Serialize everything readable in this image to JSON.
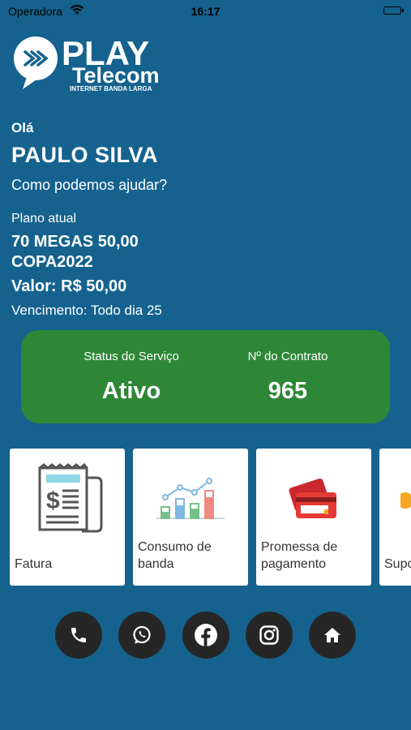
{
  "status_bar": {
    "carrier": "Operadora",
    "time": "16:17"
  },
  "brand": {
    "logo_top": "PLAY",
    "logo_bottom": "Telecom",
    "logo_tagline": "INTERNET BANDA LARGA"
  },
  "greeting": {
    "hello": "Olá",
    "name": "PAULO SILVA",
    "prompt": "Como podemos ajudar?"
  },
  "plan": {
    "label": "Plano atual",
    "name": "70 MEGAS 50,00 COPA2022",
    "price": "Valor: R$ 50,00",
    "due": "Vencimento: Todo dia 25"
  },
  "service": {
    "status_label": "Status do Serviço",
    "status_value": "Ativo",
    "contract_label": "Nº do Contrato",
    "contract_value": "965"
  },
  "menu_cards": [
    {
      "label": "Fatura",
      "icon": "invoice-icon"
    },
    {
      "label": "Consumo de banda",
      "icon": "bar-chart-icon"
    },
    {
      "label": "Promessa de pagamento",
      "icon": "credit-card-icon"
    },
    {
      "label": "Suporte",
      "icon": "support-icon"
    }
  ],
  "social_buttons": [
    {
      "icon": "phone-icon"
    },
    {
      "icon": "whatsapp-icon"
    },
    {
      "icon": "facebook-icon"
    },
    {
      "icon": "instagram-icon"
    },
    {
      "icon": "home-icon"
    }
  ],
  "colors": {
    "background": "#15628e",
    "status_card": "#2e8737",
    "social_button": "#262626"
  }
}
